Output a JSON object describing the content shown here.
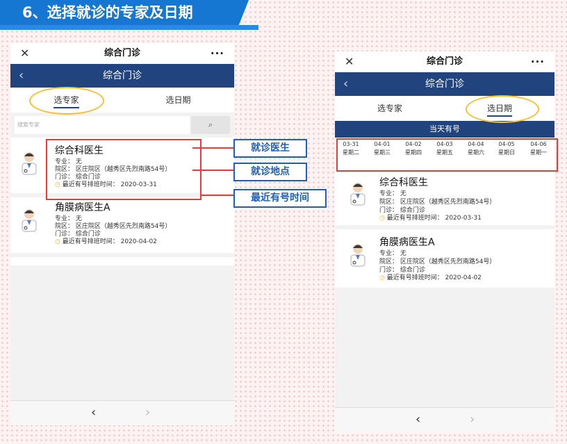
{
  "heading": "6、选择就诊的专家及日期",
  "wechat_title": "综合门诊",
  "page_title": "综合门诊",
  "tabs": {
    "expert": "选专家",
    "date": "选日期"
  },
  "search": {
    "placeholder": "搜索专家",
    "button_icon": "search-icon"
  },
  "available_label": "当天有号",
  "dates": [
    {
      "date": "03-31",
      "weekday": "星期二"
    },
    {
      "date": "04-01",
      "weekday": "星期三"
    },
    {
      "date": "04-02",
      "weekday": "星期四"
    },
    {
      "date": "04-03",
      "weekday": "星期五"
    },
    {
      "date": "04-04",
      "weekday": "星期六"
    },
    {
      "date": "04-05",
      "weekday": "星期日"
    },
    {
      "date": "04-06",
      "weekday": "星期一"
    }
  ],
  "doctors": [
    {
      "name": "综合科医生",
      "specialty": "专业：  无",
      "hospital": "院区：  区庄院区（越秀区先烈南路54号）",
      "clinic": "门诊：  综合门诊",
      "latest": "最近有号排班时间：  2020-03-31"
    },
    {
      "name": "角膜病医生A",
      "specialty": "专业：  无",
      "hospital": "院区：  区庄院区（越秀区先烈南路54号）",
      "clinic": "门诊：  综合门诊",
      "latest": "最近有号排班时间：  2020-04-02"
    }
  ],
  "callouts": {
    "doctor": "就诊医生",
    "location": "就诊地点",
    "time": "最近有号时间"
  },
  "pager": {
    "prev": "‹",
    "next": "›"
  },
  "colors": {
    "nav": "#22447e",
    "highlight": "#f7c02c",
    "callout_border": "#e83a3a",
    "label": "#1f5fb8",
    "banner": "#1677d2"
  }
}
